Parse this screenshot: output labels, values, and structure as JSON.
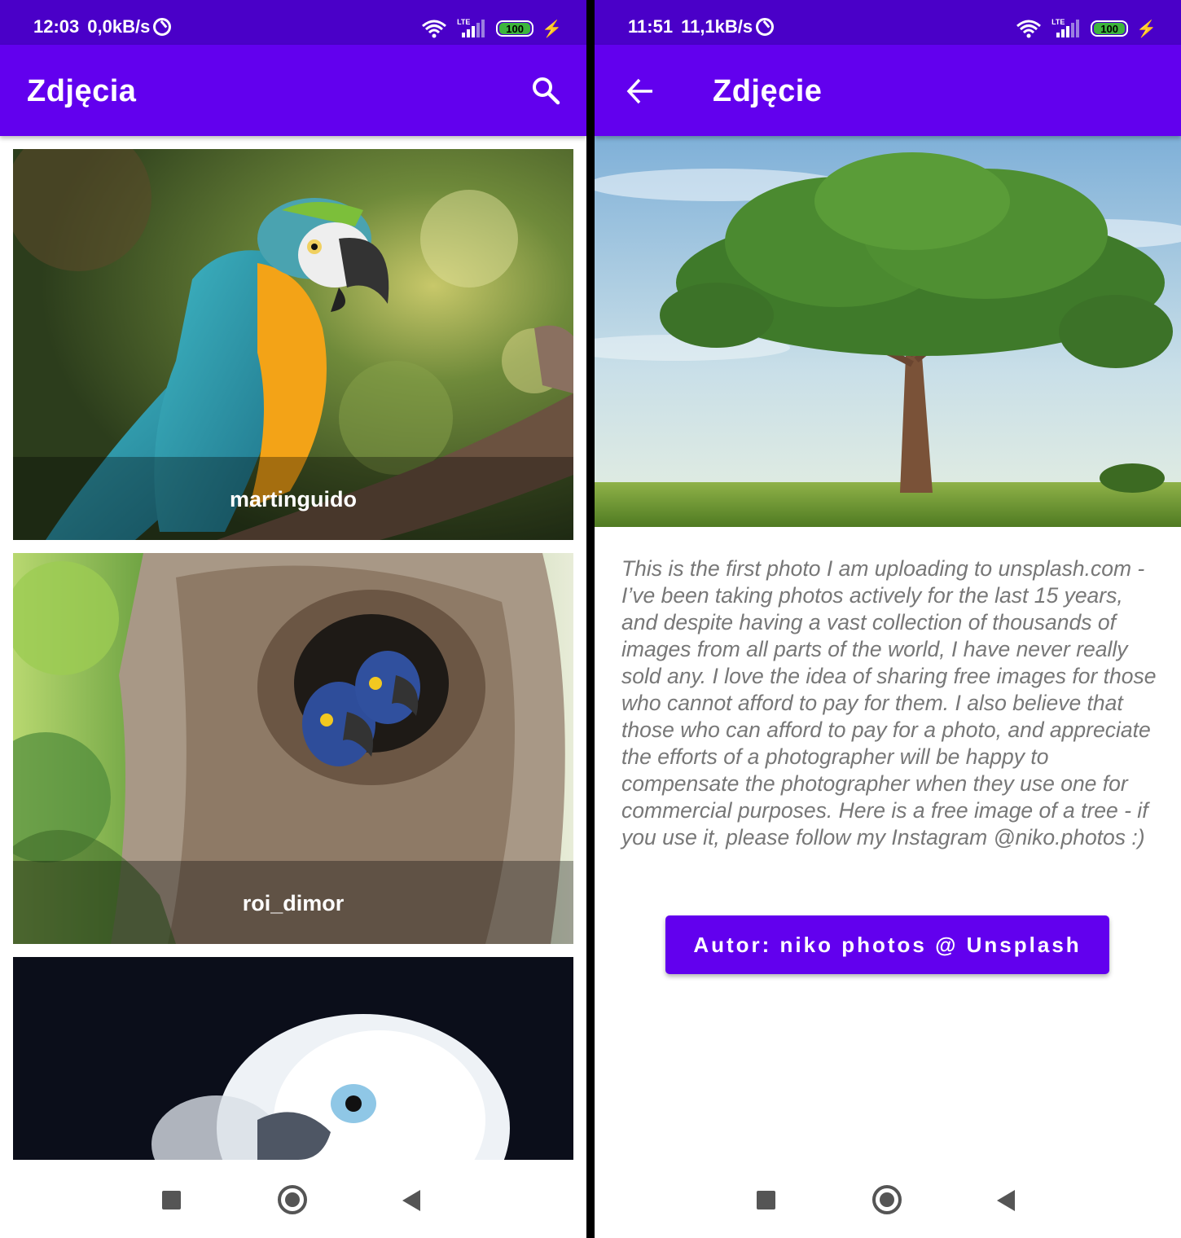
{
  "left_screen": {
    "status": {
      "time": "12:03",
      "net_speed": "0,0kB/s",
      "network": "LTE",
      "battery": "100"
    },
    "appbar": {
      "title": "Zdjęcia",
      "search_icon": "search-icon"
    },
    "cards": [
      {
        "caption": "martinguido",
        "image": "macaw-photo"
      },
      {
        "caption": "roi_dimor",
        "image": "hyacinth-macaws-in-tree-hollow-photo"
      },
      {
        "caption": "",
        "image": "white-cockatoo-photo"
      }
    ]
  },
  "right_screen": {
    "status": {
      "time": "11:51",
      "net_speed": "11,1kB/s",
      "network": "LTE",
      "battery": "100"
    },
    "appbar": {
      "title": "Zdjęcie",
      "back_icon": "arrow-back-icon"
    },
    "image": "tree-in-field-photo",
    "description": "This is the first photo I am uploading to unsplash.com - I’ve been taking photos actively for the last 15 years, and despite having a vast collection of thousands of images from all parts of the world, I have never really sold any. I love the idea of sharing free images for those who cannot afford to pay for them. I also believe that those who can afford to pay for a photo, and appreciate the efforts of a photographer will be happy to compensate the photographer when they use one for commercial purposes. Here is a free image of a tree - if you use it, please follow my Instagram @niko.photos :)",
    "author_button": "Autor: niko photos @ Unsplash"
  },
  "colors": {
    "status_bar": "#4a00c8",
    "app_bar": "#6200ee",
    "button": "#6200ee",
    "description_text": "#777777"
  }
}
